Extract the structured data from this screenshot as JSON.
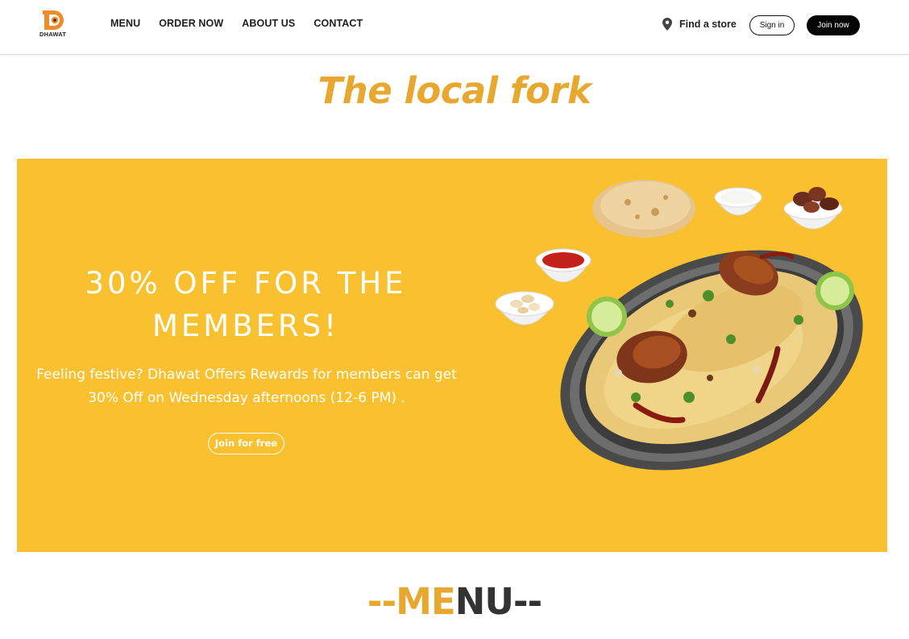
{
  "brand": {
    "name": "DHAWAT",
    "accent": "#e8a830"
  },
  "nav": {
    "links": [
      {
        "label": "MENU"
      },
      {
        "label": "ORDER NOW"
      },
      {
        "label": "ABOUT US"
      },
      {
        "label": "CONTACT"
      }
    ],
    "find_store": "Find a store",
    "find_store_icon": "map-pin-icon",
    "sign_in": "Sign in",
    "join_now": "Join now"
  },
  "headline": "The local fork",
  "promo": {
    "background": "#f9c02f",
    "title": "30% OFF FOR THE MEMBERS!",
    "description": "Feeling festive? Dhawat Offers Rewards for members can get 30% Off on Wednesday afternoons (12-6 PM) .",
    "cta": "Join for free",
    "image": "biryani-platter-image"
  },
  "menu_heading": {
    "left_dashes": "--",
    "part1": "ME",
    "part2": "NU",
    "right_dashes": "--"
  }
}
